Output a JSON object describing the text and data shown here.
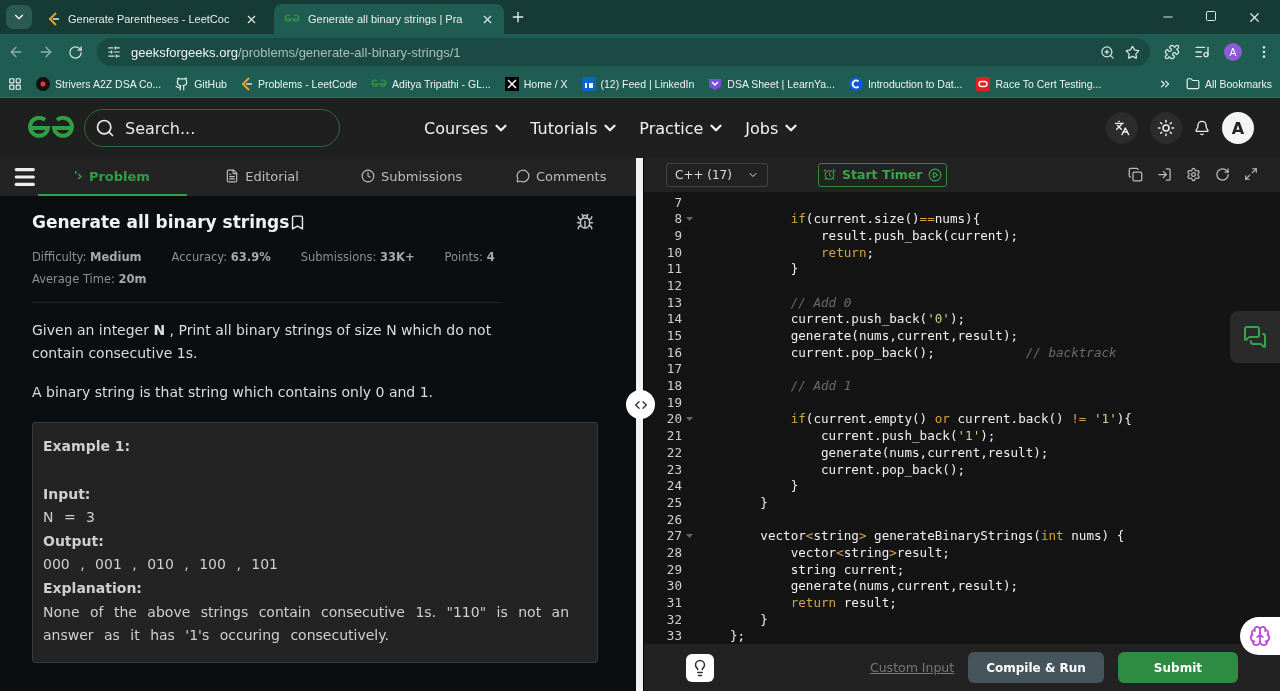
{
  "browser": {
    "tabs": [
      {
        "title": "Generate Parentheses - LeetCoc",
        "kind": "leetcode",
        "selected": false
      },
      {
        "title": "Generate all binary strings | Pra",
        "kind": "gfg",
        "selected": true
      }
    ],
    "url_host": "geeksforgeeks.org",
    "url_path": "/problems/generate-all-binary-strings/1",
    "profile": "A",
    "bookmarks": [
      {
        "label": "Strivers A2Z DSA Co...",
        "kind": "tuf"
      },
      {
        "label": "GitHub",
        "kind": "github"
      },
      {
        "label": "Problems - LeetCode",
        "kind": "leetcode"
      },
      {
        "label": "Aditya Tripathi - GL...",
        "kind": "gfg"
      },
      {
        "label": "Home / X",
        "kind": "x"
      },
      {
        "label": "(12) Feed | LinkedIn",
        "kind": "linkedin"
      },
      {
        "label": "DSA Sheet | LearnYa...",
        "kind": "learnyard"
      },
      {
        "label": "Introduction to Dat...",
        "kind": "c"
      },
      {
        "label": "Race To Cert Testing...",
        "kind": "oracle"
      }
    ],
    "all_bookmarks": "All Bookmarks"
  },
  "site": {
    "search_placeholder": "Search...",
    "nav": [
      "Courses",
      "Tutorials",
      "Practice",
      "Jobs"
    ],
    "avatar": "A"
  },
  "problem_tabs": [
    {
      "label": "Problem",
      "kind": "code",
      "selected": true
    },
    {
      "label": "Editorial",
      "kind": "doc",
      "selected": false
    },
    {
      "label": "Submissions",
      "kind": "clock",
      "selected": false
    },
    {
      "label": "Comments",
      "kind": "chat",
      "selected": false
    }
  ],
  "problem": {
    "title": "Generate all binary strings",
    "stats": [
      "Difficulty: **Medium**",
      "Accuracy: **63.9%**",
      "Submissions: **33K+**",
      "Points: **4**",
      "Average Time: **20m**"
    ],
    "paragraphs": [
      "Given an integer **N** , Print all binary strings of size N which do not contain consecutive 1s.",
      "A binary string is that string which contains only 0 and 1."
    ],
    "example": {
      "title": "Example  1:",
      "items": [
        {
          "label": "Input:",
          "value": "N = 3"
        },
        {
          "label": "Output:",
          "value": "000 , 001 , 010 , 100 , 101"
        },
        {
          "label": "Explanation:",
          "value": "None of the above strings contain consecutive 1s. \"110\" is not an answer as it has '1's occuring consecutively."
        }
      ]
    }
  },
  "editor": {
    "language": "C++ (17)",
    "timer": "Start Timer",
    "lines": [
      {
        "n": "7",
        "fold": false
      },
      {
        "n": "8",
        "fold": true,
        "tokens": [
          {
            "t": "        if",
            "kind": "kw"
          },
          {
            "t": "(current.size()",
            "kind": "plain"
          },
          {
            "t": "==",
            "kind": "kw"
          },
          {
            "t": "nums){",
            "kind": "plain"
          }
        ]
      },
      {
        "n": "9",
        "fold": false,
        "tokens": [
          {
            "t": "            result.push_back(current);",
            "kind": "plain"
          }
        ]
      },
      {
        "n": "10",
        "fold": false,
        "tokens": [
          {
            "t": "            return",
            "kind": "kw"
          },
          {
            "t": ";",
            "kind": "plain"
          }
        ]
      },
      {
        "n": "11",
        "fold": false,
        "tokens": [
          {
            "t": "        }",
            "kind": "plain"
          }
        ]
      },
      {
        "n": "12",
        "fold": false
      },
      {
        "n": "13",
        "fold": false,
        "tokens": [
          {
            "t": "        // Add 0",
            "kind": "cm"
          }
        ]
      },
      {
        "n": "14",
        "fold": false,
        "tokens": [
          {
            "t": "        current.push_back(",
            "kind": "plain"
          },
          {
            "t": "'0'",
            "kind": "str"
          },
          {
            "t": ");",
            "kind": "plain"
          }
        ]
      },
      {
        "n": "15",
        "fold": false,
        "tokens": [
          {
            "t": "        generate(nums,current,result);",
            "kind": "plain"
          }
        ]
      },
      {
        "n": "16",
        "fold": false,
        "tokens": [
          {
            "t": "        current.pop_back();",
            "kind": "plain"
          },
          {
            "t": "            // backtrack",
            "kind": "cm"
          }
        ]
      },
      {
        "n": "17",
        "fold": false
      },
      {
        "n": "18",
        "fold": false,
        "tokens": [
          {
            "t": "        // Add 1",
            "kind": "cm"
          }
        ]
      },
      {
        "n": "19",
        "fold": false
      },
      {
        "n": "20",
        "fold": true,
        "tokens": [
          {
            "t": "        if",
            "kind": "kw"
          },
          {
            "t": "(current.empty() ",
            "kind": "plain"
          },
          {
            "t": "or",
            "kind": "kw"
          },
          {
            "t": " current.back() ",
            "kind": "plain"
          },
          {
            "t": "!=",
            "kind": "kw"
          },
          {
            "t": " '1'",
            "kind": "str"
          },
          {
            "t": "){",
            "kind": "plain"
          }
        ]
      },
      {
        "n": "21",
        "fold": false,
        "tokens": [
          {
            "t": "            current.push_back(",
            "kind": "plain"
          },
          {
            "t": "'1'",
            "kind": "str"
          },
          {
            "t": ");",
            "kind": "plain"
          }
        ]
      },
      {
        "n": "22",
        "fold": false,
        "tokens": [
          {
            "t": "            generate(nums,current,result);",
            "kind": "plain"
          }
        ]
      },
      {
        "n": "23",
        "fold": false,
        "tokens": [
          {
            "t": "            current.pop_back();",
            "kind": "plain"
          }
        ]
      },
      {
        "n": "24",
        "fold": false,
        "tokens": [
          {
            "t": "        }",
            "kind": "plain"
          }
        ]
      },
      {
        "n": "25",
        "fold": false,
        "tokens": [
          {
            "t": "    }",
            "kind": "plain"
          }
        ]
      },
      {
        "n": "26",
        "fold": false
      },
      {
        "n": "27",
        "fold": true,
        "tokens": [
          {
            "t": "    vector",
            "kind": "plain"
          },
          {
            "t": "<",
            "kind": "kw"
          },
          {
            "t": "string",
            "kind": "plain"
          },
          {
            "t": ">",
            "kind": "kw"
          },
          {
            "t": " generateBinaryStrings(",
            "kind": "plain"
          },
          {
            "t": "int",
            "kind": "kw"
          },
          {
            "t": " nums) {",
            "kind": "plain"
          }
        ]
      },
      {
        "n": "28",
        "fold": false,
        "tokens": [
          {
            "t": "        vector",
            "kind": "plain"
          },
          {
            "t": "<",
            "kind": "kw"
          },
          {
            "t": "string",
            "kind": "plain"
          },
          {
            "t": ">",
            "kind": "kw"
          },
          {
            "t": "result;",
            "kind": "plain"
          }
        ]
      },
      {
        "n": "29",
        "fold": false,
        "tokens": [
          {
            "t": "        string current;",
            "kind": "plain"
          }
        ]
      },
      {
        "n": "30",
        "fold": false,
        "tokens": [
          {
            "t": "        generate(nums,current,result);",
            "kind": "plain"
          }
        ]
      },
      {
        "n": "31",
        "fold": false,
        "tokens": [
          {
            "t": "        return",
            "kind": "kw"
          },
          {
            "t": " result;",
            "kind": "plain"
          }
        ]
      },
      {
        "n": "32",
        "fold": false,
        "tokens": [
          {
            "t": "    }",
            "kind": "plain"
          }
        ]
      },
      {
        "n": "33",
        "fold": false,
        "tokens": [
          {
            "t": "};",
            "kind": "plain"
          }
        ]
      }
    ],
    "custom_input": "Custom Input",
    "compile": "Compile & Run",
    "submit": "Submit"
  }
}
